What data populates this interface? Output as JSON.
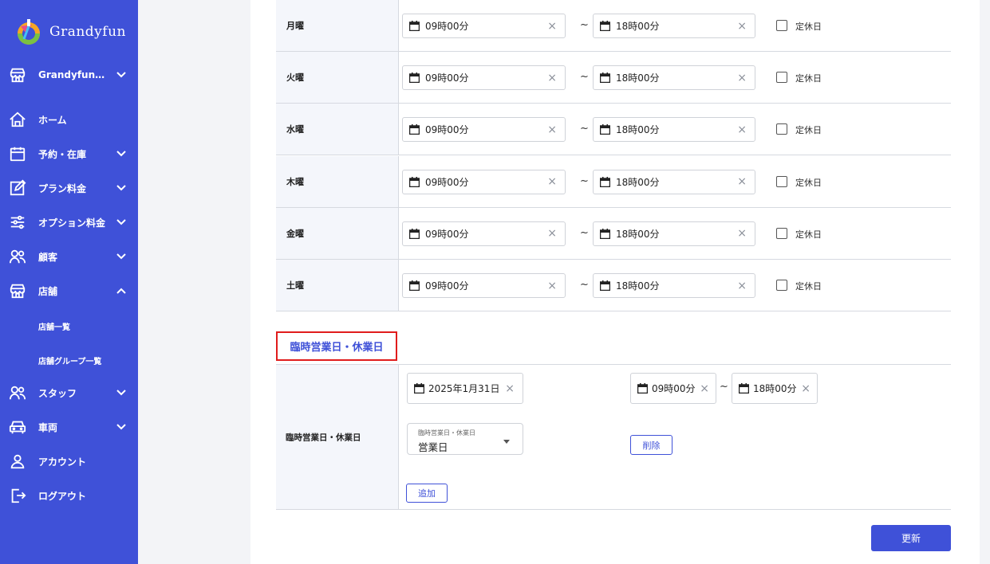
{
  "brand": {
    "name": "Grandyfun"
  },
  "sidebar": {
    "store_selector": "Grandyfun…",
    "items": [
      {
        "label": "ホーム",
        "icon": "home-icon"
      },
      {
        "label": "予約・在庫",
        "icon": "calendar-icon"
      },
      {
        "label": "プラン料金",
        "icon": "edit-icon"
      },
      {
        "label": "オプション料金",
        "icon": "sliders-icon"
      },
      {
        "label": "顧客",
        "icon": "users-icon"
      },
      {
        "label": "店舗",
        "icon": "store-icon"
      },
      {
        "label": "スタッフ",
        "icon": "users-icon"
      },
      {
        "label": "車両",
        "icon": "car-icon"
      },
      {
        "label": "アカウント",
        "icon": "user-icon"
      },
      {
        "label": "ログアウト",
        "icon": "logout-icon"
      }
    ],
    "store_sub": [
      "店舗一覧",
      "店舗グループ一覧"
    ]
  },
  "schedule": {
    "tilde": "~",
    "holiday_label": "定休日",
    "days": [
      {
        "day": "月曜",
        "start": "09時00分",
        "end": "18時00分"
      },
      {
        "day": "火曜",
        "start": "09時00分",
        "end": "18時00分"
      },
      {
        "day": "水曜",
        "start": "09時00分",
        "end": "18時00分"
      },
      {
        "day": "木曜",
        "start": "09時00分",
        "end": "18時00分"
      },
      {
        "day": "金曜",
        "start": "09時00分",
        "end": "18時00分"
      },
      {
        "day": "土曜",
        "start": "09時00分",
        "end": "18時00分"
      }
    ]
  },
  "temporary": {
    "section_title": "臨時営業日・休業日",
    "row_label": "臨時営業日・休業日",
    "date": "2025年1月31日",
    "start": "09時00分",
    "end": "18時00分",
    "type_label": "臨時営業日・休業日",
    "type_value": "営業日",
    "delete_label": "削除",
    "add_label": "追加"
  },
  "actions": {
    "update_label": "更新"
  },
  "colors": {
    "primary": "#3f51d8",
    "highlight_border": "#e01c1c"
  }
}
